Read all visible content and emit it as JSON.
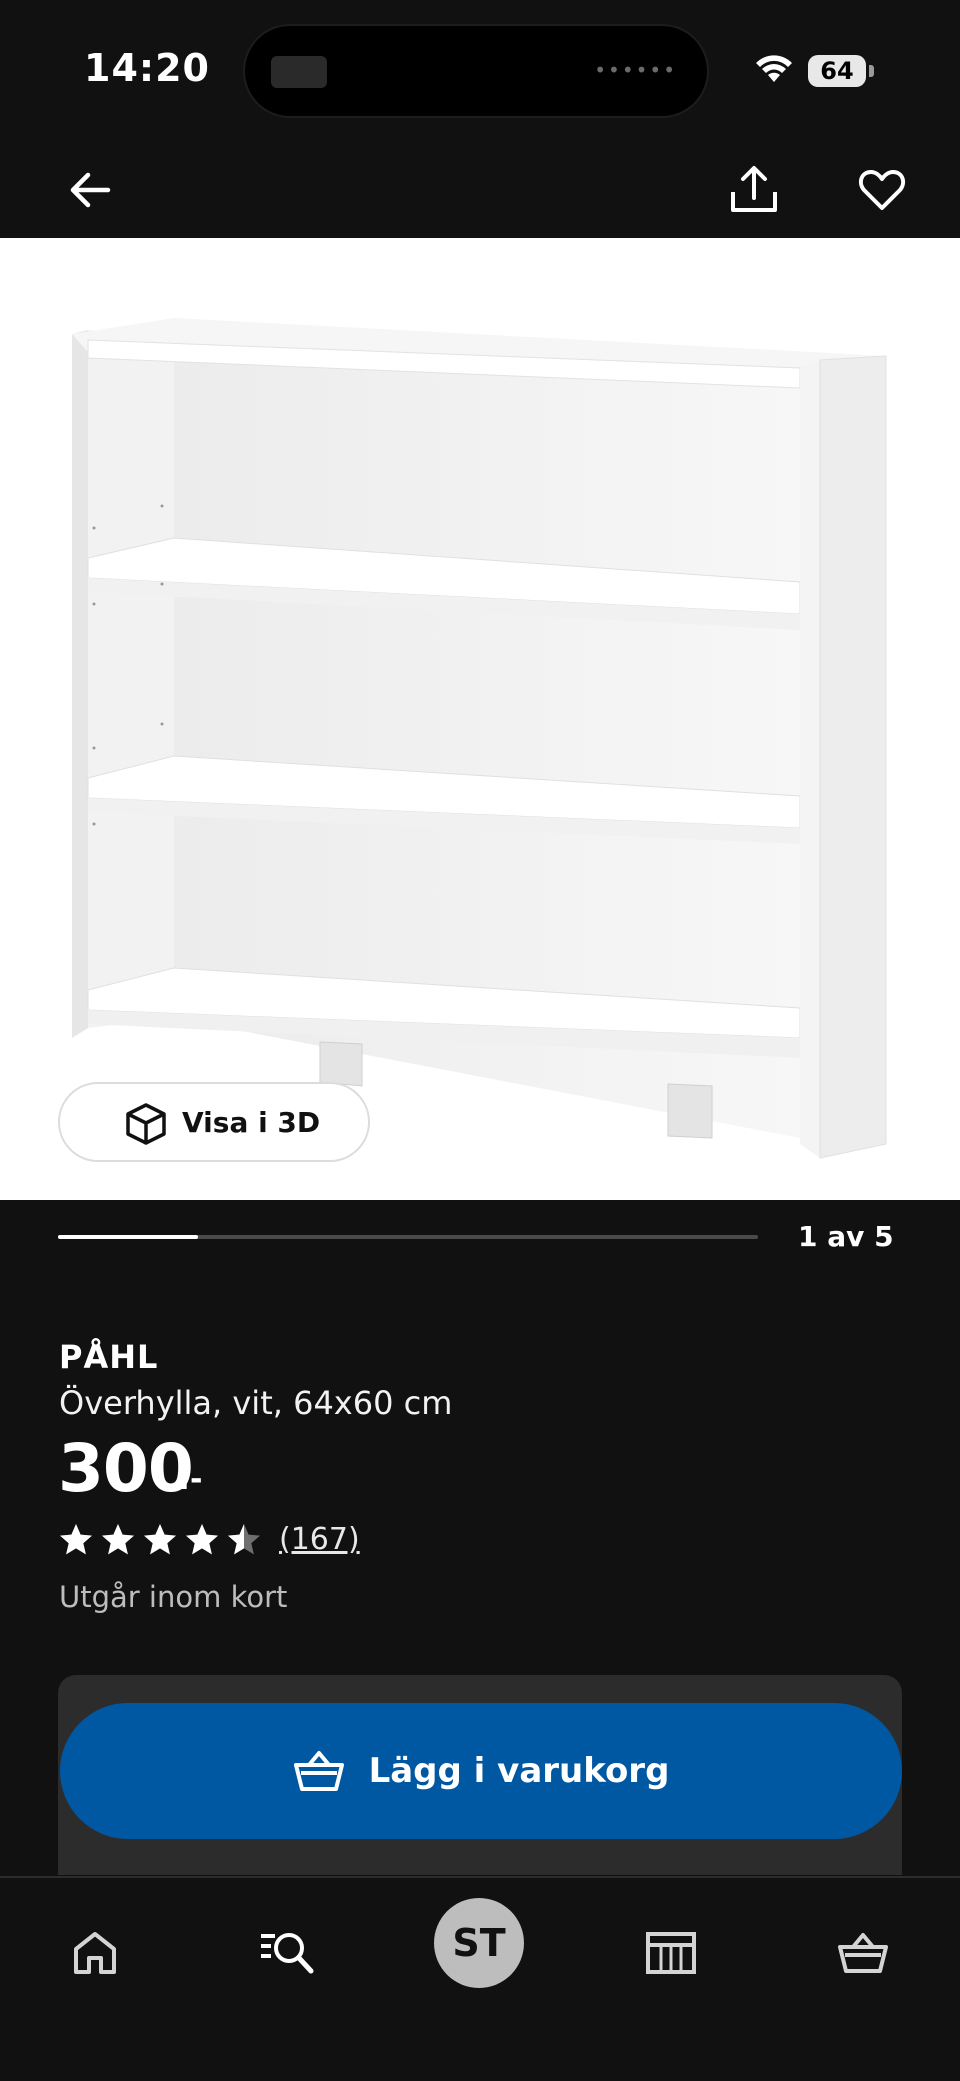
{
  "status_bar": {
    "time": "14:20",
    "battery": "64"
  },
  "nav": {
    "back_icon": "arrow-left-icon",
    "share_icon": "share-icon",
    "favorite_icon": "heart-icon"
  },
  "gallery": {
    "view_3d_label": "Visa i 3D",
    "position": "1 av 5",
    "progress_fraction": 0.2
  },
  "product": {
    "name": "PÅHL",
    "description": "Överhylla, vit, 64x60 cm",
    "price": "300",
    "price_suffix": ":-",
    "rating": 4.5,
    "review_count": "(167)",
    "stock_note": "Utgår inom kort"
  },
  "purchase": {
    "add_to_cart_label": "Lägg i varukorg",
    "accent_color": "#0058a3"
  },
  "tab_bar": {
    "items": [
      {
        "name": "home",
        "icon": "home-icon"
      },
      {
        "name": "search",
        "icon": "search-list-icon"
      },
      {
        "name": "profile",
        "initials": "ST"
      },
      {
        "name": "store",
        "icon": "store-icon"
      },
      {
        "name": "basket",
        "icon": "basket-icon"
      }
    ]
  }
}
